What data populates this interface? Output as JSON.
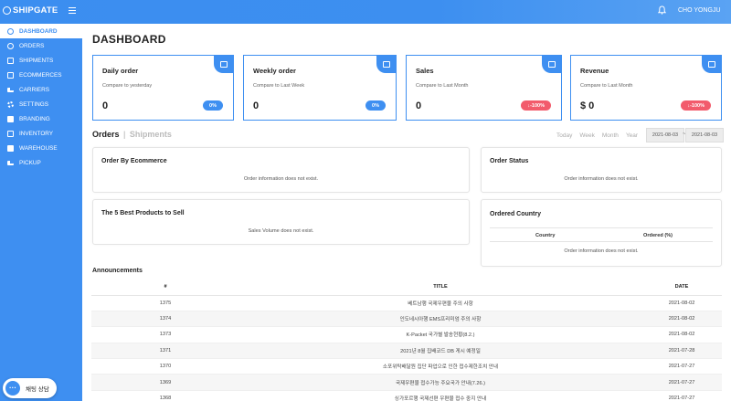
{
  "header": {
    "logo": "SHIPGATE",
    "user": "CHO YONGJU"
  },
  "sidebar": {
    "items": [
      {
        "label": "DASHBOARD",
        "icon": "dashboard-icon",
        "active": true
      },
      {
        "label": "ORDERS",
        "icon": "orders-icon"
      },
      {
        "label": "SHIPMENTS",
        "icon": "shipments-icon"
      },
      {
        "label": "ECOMMERCES",
        "icon": "ecommerce-icon"
      },
      {
        "label": "CARRIERS",
        "icon": "truck-icon"
      },
      {
        "label": "SETTINGS",
        "icon": "gear-icon"
      },
      {
        "label": "BRANDING",
        "icon": "branding-icon"
      },
      {
        "label": "INVENTORY",
        "icon": "inventory-icon"
      },
      {
        "label": "WAREHOUSE",
        "icon": "warehouse-icon"
      },
      {
        "label": "PICKUP",
        "icon": "pickup-icon"
      }
    ]
  },
  "chat": {
    "label": "채팅 상담"
  },
  "page": {
    "title": "DASHBOARD"
  },
  "cards": [
    {
      "title": "Daily order",
      "sub": "Compare to yesterday",
      "value": "0",
      "badge": "0%",
      "badge_color": "#3e8ff1",
      "icon": "gift-icon"
    },
    {
      "title": "Weekly order",
      "sub": "Compare to Last Week",
      "value": "0",
      "badge": "0%",
      "badge_color": "#3e8ff1",
      "icon": "calendar-icon"
    },
    {
      "title": "Sales",
      "sub": "Compare to Last Month",
      "value": "0",
      "badge": "↓-100%",
      "badge_color": "#f25b6c",
      "icon": "bag-icon"
    },
    {
      "title": "Revenue",
      "sub": "Compare to Last Month",
      "value": "$ 0",
      "badge": "↓-100%",
      "badge_color": "#f25b6c",
      "icon": "chart-icon"
    }
  ],
  "section": {
    "tab_orders": "Orders",
    "separator": "|",
    "tab_shipments": "Shipments",
    "ranges": [
      "Today",
      "Week",
      "Month",
      "Year"
    ],
    "date_from": "2021-08-03",
    "date_to": "2021-08-03",
    "date_dash": "~"
  },
  "panels": {
    "by_ecommerce": {
      "title": "Order By Ecommerce",
      "msg": "Order information does not exist."
    },
    "status": {
      "title": "Order Status",
      "msg": "Order information does not exist."
    },
    "best": {
      "title": "The 5 Best Products to Sell",
      "msg": "Sales Volume does not exist."
    },
    "country": {
      "title": "Ordered Country",
      "col_country": "Country",
      "col_ordered": "Ordered (%)",
      "msg": "Order information does not exist."
    }
  },
  "announcements": {
    "title": "Announcements",
    "columns": [
      "#",
      "TITLE",
      "DATE"
    ],
    "rows": [
      {
        "num": "1375",
        "title": "베트남행 국제우편물 주의 사항",
        "date": "2021-08-02"
      },
      {
        "num": "1374",
        "title": "인도네시아행 EMS프리미엄 주의 사항",
        "date": "2021-08-02"
      },
      {
        "num": "1373",
        "title": "K-Packet 국가별 발송현황(8.2.)",
        "date": "2021-08-02"
      },
      {
        "num": "1371",
        "title": "2021년 8월 집배코드 DB 게시 예정일",
        "date": "2021-07-28"
      },
      {
        "num": "1370",
        "title": "소포위탁배달원 집단 파업으로 인한 접수제한조치 안내",
        "date": "2021-07-27"
      },
      {
        "num": "1369",
        "title": "국제우편물 접수가능 주요국가 안내(7.26.)",
        "date": "2021-07-27"
      },
      {
        "num": "1368",
        "title": "싱가포르행 국제선편 우편물 접수 중지 안내",
        "date": "2021-07-27"
      }
    ]
  },
  "colors": {
    "primary": "#3e8ff1",
    "danger": "#f25b6c"
  }
}
